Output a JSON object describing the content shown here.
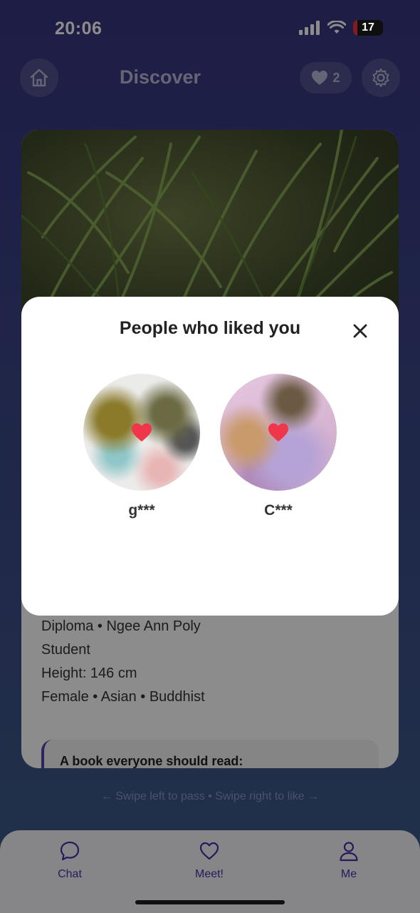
{
  "status_bar": {
    "time": "20:06",
    "battery": "17"
  },
  "header": {
    "title": "Discover",
    "likes_count": "2"
  },
  "profile": {
    "details": [
      "Diploma • Ngee Ann Poly",
      "Student",
      "Height: 146 cm",
      "Female • Asian • Buddhist"
    ],
    "prompt": "A book everyone should read:"
  },
  "swipe_hint": "← Swipe left to pass • Swipe right to like →",
  "tabs": [
    {
      "label": "Chat",
      "icon": "chat-bubble-icon"
    },
    {
      "label": "Meet!",
      "icon": "heart-outline-icon"
    },
    {
      "label": "Me",
      "icon": "person-icon"
    }
  ],
  "modal": {
    "title": "People who liked you",
    "likers": [
      {
        "name": "g***"
      },
      {
        "name": "C***"
      }
    ]
  },
  "colors": {
    "accent": "#4b2fa8",
    "heart": "#f0364b",
    "background_top": "#37357f",
    "background_bottom": "#3c5b89"
  }
}
